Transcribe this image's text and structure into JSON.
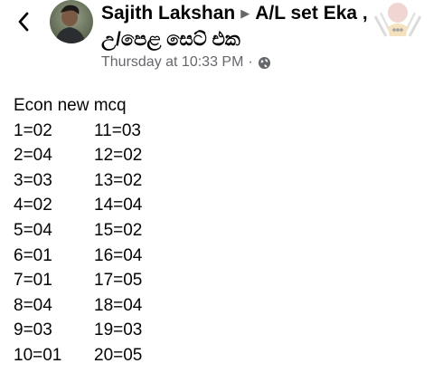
{
  "header": {
    "author": "Sajith Lakshan",
    "group": "A/L set Eka ,",
    "group_line2": "උ/පෙළ සෙට් එක",
    "timestamp": "Thursday at 10:33 PM",
    "separator": "·",
    "privacy_icon": "globe-icon"
  },
  "post": {
    "title": "Econ new mcq",
    "rows": [
      {
        "a": "1=02",
        "b": "11=03"
      },
      {
        "a": "2=04",
        "b": "12=02"
      },
      {
        "a": "3=03",
        "b": "13=02"
      },
      {
        "a": "4=02",
        "b": "14=04"
      },
      {
        "a": "5=04",
        "b": "15=02"
      },
      {
        "a": "6=01",
        "b": "16=04"
      },
      {
        "a": "7=01",
        "b": "17=05"
      },
      {
        "a": "8=04",
        "b": "18=04"
      },
      {
        "a": "9=03",
        "b": "19=03"
      },
      {
        "a": "10=01",
        "b": "20=05"
      }
    ]
  },
  "colors": {
    "text": "#050505",
    "secondary": "#65676b",
    "background": "#ffffff"
  }
}
